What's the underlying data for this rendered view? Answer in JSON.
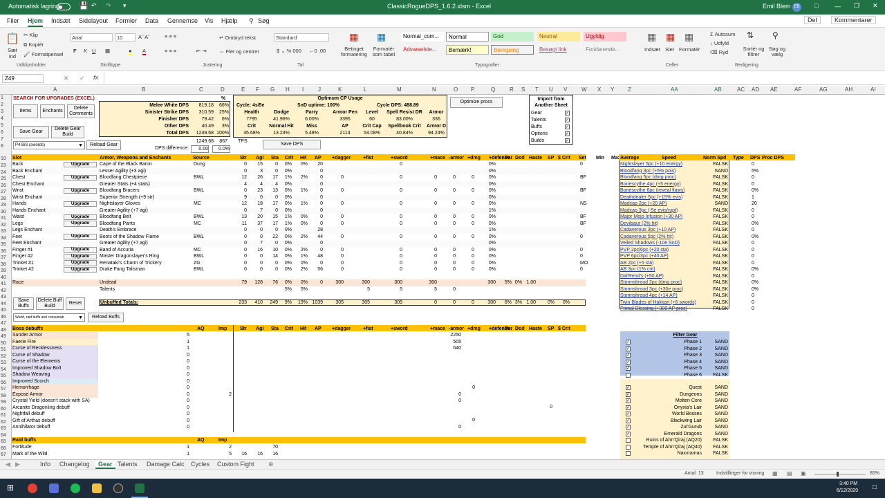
{
  "titlebar": {
    "autosave": "Automatisk lagring",
    "filename": "ClassicRogueDPS_1.6.2.xlsm - Excel",
    "user": "Emil Blem",
    "user_initials": "EB"
  },
  "menu": {
    "tabs": [
      "Filer",
      "Hjem",
      "Indsæt",
      "Sidelayout",
      "Formler",
      "Data",
      "Gennemse",
      "Vis",
      "Hjælp",
      "Søg"
    ],
    "share": "Del",
    "comments": "Kommentarer"
  },
  "ribbon": {
    "paste": "Sæt ind",
    "cut": "Klip",
    "copy": "Kopiér",
    "painter": "Formatpensel",
    "font_name": "Arial",
    "font_size": "10",
    "wrap": "Ombryd tekst",
    "merge": "Flet og centrer",
    "numfmt": "Standard",
    "cond": "Betinget formatering",
    "table": "Formatér som tabel",
    "styles": [
      "Normal_com...",
      "Normal",
      "God",
      "Neutral",
      "Ugyldig",
      "Advarselste...",
      "Bemærk!",
      "Beregning",
      "Besøgt link",
      "Forklarende..."
    ],
    "insert": "Indsæt",
    "delete": "Slet",
    "format": "Formatér",
    "autosum": "Autosum",
    "fill": "Udfyld",
    "clear": "Ryd",
    "sort": "Sortér og filtrer",
    "find": "Søg og vælg",
    "groups": [
      "Udklipsholder",
      "Skrifttype",
      "Justering",
      "Tal",
      "Typografier",
      "Celler",
      "Redigering"
    ]
  },
  "formula_bar": {
    "namebox": "Z49",
    "fx": "fx",
    "value": ""
  },
  "columns": [
    "A",
    "B",
    "C",
    "D",
    "E",
    "F",
    "G",
    "H",
    "I",
    "J",
    "K",
    "L",
    "M",
    "N",
    "O",
    "P",
    "Q",
    "R",
    "S",
    "T",
    "U",
    "V",
    "W",
    "X",
    "Y",
    "Z",
    "AA",
    "AB",
    "AC",
    "AD",
    "AE",
    "AF",
    "AG",
    "AH",
    "AI"
  ],
  "rows": [
    "1",
    "2",
    "3",
    "4",
    "5",
    "6",
    "7",
    "8",
    "10",
    "23",
    "24",
    "25",
    "26",
    "27",
    "28",
    "29",
    "30",
    "31",
    "32",
    "33",
    "34",
    "35",
    "36",
    "37",
    "38",
    "39",
    "40",
    "41",
    "42",
    "43",
    "44",
    "45",
    "46",
    "47",
    "48",
    "49",
    "50",
    "51",
    "52",
    "53",
    "54",
    "55",
    "56",
    "57",
    "58",
    "59",
    "60",
    "61",
    "62",
    "63",
    "64",
    "65",
    "66",
    "67"
  ],
  "top": {
    "search_title": "SEARCH FOR UPGRADES (EXCEL)",
    "items": "Items",
    "enchants": "Enchants",
    "delete_comments": "Delete Comments",
    "save_gear": "Save Gear",
    "delete_gear_build": "Delete Gear Build",
    "gear_dropdown": "P4 BiS (swords)",
    "reload_gear": "Reload Gear",
    "dps_rows": [
      {
        "label": "Melee White DPS",
        "v": "819.18",
        "p": "66%"
      },
      {
        "label": "Sinister Strike DPS",
        "v": "310.59",
        "p": "25%"
      },
      {
        "label": "Finisher DPS",
        "v": "79.42",
        "p": "6%"
      },
      {
        "label": "Other DPS",
        "v": "40.49",
        "p": "3%"
      },
      {
        "label": "Total DPS",
        "v": "1249.68",
        "p": "100%"
      }
    ],
    "pct_header": "%",
    "dps2": "1249.68",
    "tps": "867",
    "tps_label": "TPS",
    "dps_diff_label": "DPS difference:",
    "dps_diff": "0.00",
    "dps_diff_pct": "0.0%",
    "save_dps": "Save DPS",
    "cp_title": "Optimum CP Usage",
    "cycle": "Cycle: 4s/5e",
    "snd": "SnD uptime: 100%",
    "cycle_dps": "Cycle DPS: 488.89",
    "stat_headers": [
      "Health",
      "Dodge",
      "Parry",
      "Armor Pen",
      "Level",
      "Spell Resist DR",
      "Armor"
    ],
    "stat_values": [
      "7795",
      "41.96%",
      "6.00%",
      "3395",
      "60",
      "83.00%",
      "336"
    ],
    "stat_headers2": [
      "Crit",
      "Normal Hit",
      "Miss",
      "AP",
      "Crit Cap",
      "Spellbook Crit",
      "Armor DR"
    ],
    "stat_values2": [
      "35.68%",
      "13.24%",
      "5.48%",
      "2114",
      "54.08%",
      "40.84%",
      "94.24%"
    ],
    "optimize": "Optimize procs",
    "import_title": "Import from Another Sheet",
    "import_items": [
      "Gear",
      "Talents",
      "Buffs",
      "Options",
      "Builds"
    ]
  },
  "gear_headers": [
    "Slot",
    "Armor, Weapons and Enchants",
    "Source",
    "Str",
    "Agi",
    "Sta",
    "Crit",
    "Hit",
    "AP",
    "+dagger",
    "+fist",
    "+sword",
    "+mace",
    "-armor",
    "+dmg",
    "+defense",
    "Par",
    "Dod",
    "Haste",
    "SP",
    "$ Crit",
    "Set",
    "Min",
    "Max"
  ],
  "upgrade_label": "Upgrade",
  "gear_rows": [
    {
      "slot": "Back",
      "up": true,
      "item": "Cape of the Black Baron",
      "src": "Dung",
      "v": [
        "0",
        "15",
        "0",
        "0%",
        "0%",
        "20",
        "",
        "",
        "0",
        "",
        "",
        "",
        "0%"
      ],
      "set": "0",
      "fill": ""
    },
    {
      "slot": "Back Enchant",
      "up": false,
      "item": "Lesser Agility (+3 agi)",
      "src": "",
      "v": [
        "0",
        "3",
        "0",
        "0%",
        "",
        "0",
        "",
        "",
        "",
        "",
        "",
        "",
        "0%"
      ],
      "set": "",
      "fill": "ench"
    },
    {
      "slot": "Chest",
      "up": true,
      "item": "Bloodfang Chestpiece",
      "src": "BWL",
      "v": [
        "12",
        "26",
        "17",
        "1%",
        "2%",
        "0",
        "0",
        "",
        "0",
        "0",
        "0",
        "0",
        "0%"
      ],
      "set": "BF",
      "fill": ""
    },
    {
      "slot": "Chest Enchant",
      "up": false,
      "item": "Greater Stats (+4 stats)",
      "src": "",
      "v": [
        "4",
        "4",
        "4",
        "0%",
        "",
        "0",
        "",
        "",
        "",
        "",
        "",
        "",
        "0%"
      ],
      "set": "",
      "fill": "ench"
    },
    {
      "slot": "Wrist",
      "up": true,
      "item": "Bloodfang Bracers",
      "src": "BWL",
      "v": [
        "0",
        "23",
        "13",
        "0%",
        "1%",
        "0",
        "0",
        "",
        "0",
        "0",
        "0",
        "0",
        "0%"
      ],
      "set": "BF",
      "fill": ""
    },
    {
      "slot": "Wrist Enchant",
      "up": false,
      "item": "Superior Strength (+9 str)",
      "src": "",
      "v": [
        "9",
        "0",
        "0",
        "0%",
        "",
        "0",
        "",
        "",
        "",
        "",
        "",
        "",
        "0%"
      ],
      "set": "",
      "fill": "ench"
    },
    {
      "slot": "Hands",
      "up": true,
      "item": "Nightslayer Gloves",
      "src": "MC",
      "v": [
        "12",
        "18",
        "17",
        "0%",
        "1%",
        "0",
        "0",
        "",
        "0",
        "0",
        "0",
        "0",
        "0%"
      ],
      "set": "NS",
      "fill": ""
    },
    {
      "slot": "Hands Enchant",
      "up": false,
      "item": "Greater Agility (+7 agi)",
      "src": "",
      "v": [
        "0",
        "7",
        "0",
        "0%",
        "",
        "0",
        "",
        "",
        "",
        "",
        "",
        "",
        "1%"
      ],
      "set": "",
      "fill": "ench"
    },
    {
      "slot": "Waist",
      "up": true,
      "item": "Bloodfang Belt",
      "src": "BWL",
      "v": [
        "13",
        "20",
        "15",
        "1%",
        "0%",
        "0",
        "0",
        "",
        "0",
        "0",
        "0",
        "0",
        "0%"
      ],
      "set": "BF",
      "fill": ""
    },
    {
      "slot": "Legs",
      "up": true,
      "item": "Bloodfang Pants",
      "src": "MC",
      "v": [
        "11",
        "37",
        "17",
        "1%",
        "0%",
        "0",
        "0",
        "",
        "0",
        "0",
        "0",
        "0",
        "0%"
      ],
      "set": "BF",
      "fill": ""
    },
    {
      "slot": "Legs Enchant",
      "up": false,
      "item": "Death's Embrace",
      "src": "",
      "v": [
        "0",
        "0",
        "0",
        "0%",
        "",
        "28",
        "",
        "",
        "",
        "",
        "",
        "",
        "1%"
      ],
      "set": "",
      "fill": "ench"
    },
    {
      "slot": "Feet",
      "up": true,
      "item": "Boots of the Shadow Flame",
      "src": "BWL",
      "v": [
        "0",
        "0",
        "22",
        "0%",
        "2%",
        "44",
        "0",
        "",
        "0",
        "0",
        "0",
        "0",
        "0%"
      ],
      "set": "0",
      "fill": ""
    },
    {
      "slot": "Feet Enchant",
      "up": false,
      "item": "Greater Agility (+7 agi)",
      "src": "",
      "v": [
        "0",
        "7",
        "0",
        "0%",
        "",
        "0",
        "",
        "",
        "",
        "",
        "",
        "",
        "0%"
      ],
      "set": "",
      "fill": "ench"
    },
    {
      "slot": "Finger #1",
      "up": true,
      "item": "Band of Accuria",
      "src": "MC",
      "v": [
        "0",
        "16",
        "10",
        "0%",
        "2%",
        "0",
        "0",
        "",
        "0",
        "0",
        "0",
        "0",
        "0%"
      ],
      "set": "0",
      "fill": ""
    },
    {
      "slot": "Finger #2",
      "up": true,
      "item": "Master Dragonslayer's Ring",
      "src": "BWL",
      "v": [
        "0",
        "0",
        "14",
        "0%",
        "1%",
        "48",
        "0",
        "",
        "0",
        "0",
        "0",
        "0",
        "0%"
      ],
      "set": "0",
      "fill": ""
    },
    {
      "slot": "Trinket #1",
      "up": true,
      "item": "Renataki's Charm of Trickery",
      "src": "ZG",
      "v": [
        "0",
        "0",
        "0",
        "0%",
        "0%",
        "0",
        "0",
        "",
        "0",
        "0",
        "0",
        "0",
        "0%"
      ],
      "set": "MO",
      "fill": ""
    },
    {
      "slot": "Trinket #2",
      "up": true,
      "item": "Drake Fang Talisman",
      "src": "BWL",
      "v": [
        "0",
        "0",
        "0",
        "0%",
        "2%",
        "56",
        "0",
        "",
        "0",
        "0",
        "0",
        "0",
        "0%"
      ],
      "set": "0",
      "fill": ""
    }
  ],
  "race_row": {
    "slot": "Race",
    "item": "Undead",
    "v": [
      "79",
      "128",
      "76",
      "0%",
      "0%",
      "0",
      "300",
      "300",
      "300",
      "300",
      "",
      "",
      "300",
      "5%",
      "0%",
      "1.00"
    ]
  },
  "talents_row": {
    "item": "Talents",
    "v": [
      "5%",
      "5%",
      "5",
      "5",
      "5",
      "0"
    ]
  },
  "unbuffed": {
    "label": "Unbuffed Totals:",
    "v": [
      "233",
      "410",
      "249",
      "9%",
      "19%",
      "1039",
      "305",
      "305",
      "309",
      "0",
      "0",
      "0",
      "300",
      "6%",
      "3%",
      "1.00",
      "0%",
      "0%"
    ]
  },
  "buffs_block": {
    "save": "Save Buffs",
    "delete": "Delete Buff Build",
    "reset": "Reset",
    "dropdown": "World, raid buffs and consumab",
    "reload": "Reload Buffs"
  },
  "boss_headers": [
    "Boss debuffs",
    "AQ",
    "Imp",
    "Str",
    "Agi",
    "Sta",
    "Crit",
    "Hit",
    "AP",
    "+dagger",
    "+fist",
    "+sword",
    "+mace",
    "-armor",
    "+dmg",
    "+defense",
    "Par",
    "Dod",
    "Haste",
    "SP",
    "$ Crit"
  ],
  "boss_rows": [
    {
      "name": "Sunder Armor",
      "aq": "5",
      "imp": "",
      "armor": "2250",
      "fill": "#fbe5d6"
    },
    {
      "name": "Faerie Fire",
      "aq": "1",
      "imp": "",
      "armor": "505",
      "fill": "#fff2cc"
    },
    {
      "name": "Curse of Recklessness",
      "aq": "1",
      "imp": "",
      "armor": "640",
      "fill": "#e4dff2"
    },
    {
      "name": "Curse of Shadow",
      "aq": "0",
      "imp": "",
      "armor": "",
      "fill": "#e4dff2"
    },
    {
      "name": "Curse of the Elements",
      "aq": "0",
      "imp": "",
      "armor": "",
      "fill": "#e4dff2"
    },
    {
      "name": "Improved Shadow Bolt",
      "aq": "0",
      "imp": "",
      "armor": "",
      "fill": "#e4dff2"
    },
    {
      "name": "Shadow Weaving",
      "aq": "0",
      "imp": "",
      "armor": "",
      "fill": "#e4dff2"
    },
    {
      "name": "Improved Scorch",
      "aq": "0",
      "imp": "",
      "armor": "",
      "fill": "#ddebf7"
    },
    {
      "name": "Hemorrhage",
      "aq": "0",
      "imp": "",
      "armor": "",
      "fill": "#fbe5d6"
    },
    {
      "name": "Expose Armor",
      "aq": "0",
      "imp": "2",
      "armor": "0",
      "fill": "#fbe5d6"
    },
    {
      "name": "Crystal Yield (doesn't stack with SA)",
      "aq": "0",
      "imp": "",
      "armor": "0",
      "fill": ""
    },
    {
      "name": "Arcanite Dragonling debuff",
      "aq": "0",
      "imp": "",
      "armor": "",
      "fill": ""
    },
    {
      "name": "Nightfall debuff",
      "aq": "0",
      "imp": "",
      "armor": "",
      "fill": ""
    },
    {
      "name": "Gift of Arthas debuff",
      "aq": "0",
      "imp": "",
      "armor": "",
      "fill": ""
    },
    {
      "name": "Annihilator debuff",
      "aq": "0",
      "imp": "",
      "armor": "0",
      "fill": ""
    }
  ],
  "raid_headers": [
    "Raid buffs",
    "AQ",
    "Imp"
  ],
  "raid_rows": [
    {
      "name": "Fortitude",
      "aq": "1",
      "imp": "2",
      "sta": "70"
    },
    {
      "name": "Mark of the Wild",
      "aq": "1",
      "imp": "5",
      "str": "16",
      "agi": "16",
      "sta": "16"
    }
  ],
  "sets_headers": [
    "Average",
    "Speed",
    "Norm Spd",
    "Type",
    "DPS",
    "Proc DPS"
  ],
  "sets": [
    {
      "name": "Nightslayer 5pc (+10 energy)",
      "flag": "FALSK",
      "dps": "0"
    },
    {
      "name": "Bloodfang 3pc (+5% pois)",
      "flag": "SAND",
      "dps": "5%"
    },
    {
      "name": "Bloodfang 5pc (dmg proc)",
      "flag": "FALSK",
      "dps": "0"
    },
    {
      "name": "Bonescythe 4pc (+5 energy)",
      "flag": "FALSK",
      "dps": "0"
    },
    {
      "name": "Bonescythe 6pc (reveal flaws)",
      "flag": "FALSK",
      "dps": "0%"
    },
    {
      "name": "Deathdealer 5pc (+15% evis)",
      "flag": "FALSK",
      "dps": "1"
    },
    {
      "name": "Madcap 2pc (+20 AP)",
      "flag": "SAND",
      "dps": "20"
    },
    {
      "name": "Madcap 3pc (-5e evis/rupt)",
      "flag": "FALSK",
      "dps": "0"
    },
    {
      "name": "Major Mojo Infusion (+30 AP)",
      "flag": "FALSK",
      "dps": "0"
    },
    {
      "name": "Devilsaur (2% hit)",
      "flag": "FALSK",
      "dps": "0%"
    },
    {
      "name": "Cadaverous 3pc (+10 AP)",
      "flag": "FALSK",
      "dps": "0"
    },
    {
      "name": "Cadaverous 5pc (2% hit)",
      "flag": "FALSK",
      "dps": "0%"
    },
    {
      "name": "Veiled Shadows (-10e SnD)",
      "flag": "FALSK",
      "dps": "0"
    },
    {
      "name": "PVP 2pc/6pc (+20 sta)",
      "flag": "FALSK",
      "dps": "0"
    },
    {
      "name": "PVP 6pc/3pc (+40 AP)",
      "flag": "FALSK",
      "dps": "0"
    },
    {
      "name": "AB 2pc (+5 sta)",
      "flag": "FALSK",
      "dps": "0"
    },
    {
      "name": "AB 3pc (1% crit)",
      "flag": "FALSK",
      "dps": "0%"
    },
    {
      "name": "Dal'Rend's (+50 AP)",
      "flag": "FALSK",
      "dps": "0"
    },
    {
      "name": "Stormshroud 2pc (dmg proc)",
      "flag": "FALSK",
      "dps": "0%"
    },
    {
      "name": "Stormshroud 3pc (+30e proc)",
      "flag": "FALSK",
      "dps": "0%"
    },
    {
      "name": "Stormshroud 4pc (+14 AP)",
      "flag": "FALSK",
      "dps": "0"
    },
    {
      "name": "Twin Blades of Hakkari (+6 swords)",
      "flag": "FALSK",
      "dps": "0"
    },
    {
      "name": "Primal Blessing (+300 AP proc)",
      "flag": "FALSK",
      "dps": "0"
    }
  ],
  "filter": {
    "title": "Filter Gear",
    "phases": [
      {
        "name": "Phase 1",
        "v": "SAND",
        "on": true
      },
      {
        "name": "Phase 2",
        "v": "SAND",
        "on": true
      },
      {
        "name": "Phase 3",
        "v": "SAND",
        "on": true
      },
      {
        "name": "Phase 4",
        "v": "SAND",
        "on": true
      },
      {
        "name": "Phase 5",
        "v": "SAND",
        "on": true
      },
      {
        "name": "Phase 6",
        "v": "FALSK",
        "on": false
      }
    ],
    "sources": [
      {
        "name": "Quest",
        "v": "SAND",
        "on": true
      },
      {
        "name": "Dungeons",
        "v": "SAND",
        "on": true
      },
      {
        "name": "Molten Core",
        "v": "SAND",
        "on": true
      },
      {
        "name": "Onyxia's Lair",
        "v": "SAND",
        "on": true
      },
      {
        "name": "World Bosses",
        "v": "SAND",
        "on": true
      },
      {
        "name": "Blackwing Lair",
        "v": "SAND",
        "on": true
      },
      {
        "name": "Zul'Gurub",
        "v": "SAND",
        "on": true
      },
      {
        "name": "Emerald Dragons",
        "v": "SAND",
        "on": true
      },
      {
        "name": "Ruins of Ahn'Qiraj (AQ20)",
        "v": "FALSK",
        "on": false
      },
      {
        "name": "Temple of Ahn'Qiraj (AQ40)",
        "v": "FALSK",
        "on": false
      },
      {
        "name": "Naxxramas",
        "v": "FALSK",
        "on": false
      }
    ]
  },
  "misc": {
    "p57": "0",
    "p60": "0",
    "v59": "0"
  },
  "sheets": [
    "Info",
    "Changelog",
    "Gear",
    "Talents",
    "Damage Calc",
    "Cycles",
    "Custom Fight"
  ],
  "active_sheet": "Gear",
  "status": {
    "count": "Antal: 13",
    "display": "Indstillinger for visning",
    "zoom": "85%"
  },
  "clock": {
    "time": "3:40 PM",
    "date": "6/12/2020"
  }
}
